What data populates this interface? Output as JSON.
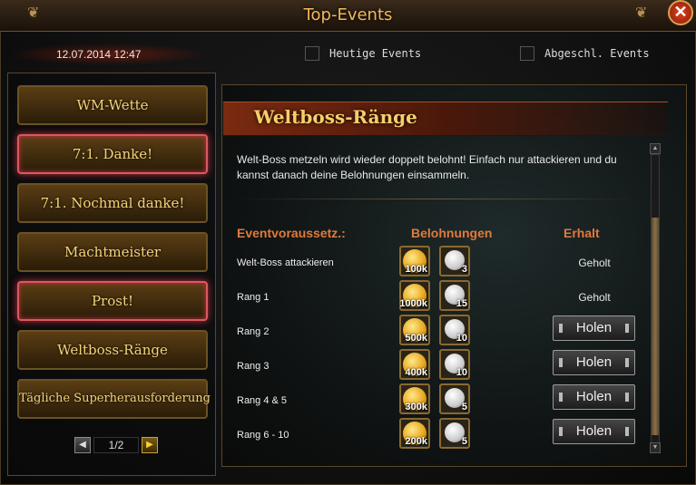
{
  "window": {
    "title": "Top-Events",
    "close_label": "✕"
  },
  "header": {
    "datetime": "12.07.2014 12:47",
    "checkbox_today": "Heutige Events",
    "checkbox_closed": "Abgeschl. Events"
  },
  "sidebar": {
    "items": [
      {
        "label": "WM-Wette",
        "active": false
      },
      {
        "label": "7:1. Danke!",
        "active": true
      },
      {
        "label": "7:1. Nochmal danke!",
        "active": false
      },
      {
        "label": "Machtmeister",
        "active": false
      },
      {
        "label": "Prost!",
        "active": true
      },
      {
        "label": "Weltboss-Ränge",
        "active": false
      },
      {
        "label": "Tägliche Superherausforderung",
        "active": false
      }
    ],
    "pager": {
      "prev": "◀",
      "label": "1/2",
      "next": "▶"
    }
  },
  "detail": {
    "title": "Weltboss-Ränge",
    "description": "Welt-Boss metzeln wird wieder doppelt belohnt! Einfach nur attackieren und du kannst danach deine Belohnungen einsammeln.",
    "headers": {
      "requirement": "Eventvoraussetz.:",
      "rewards": "Belohnungen",
      "status": "Erhalt"
    },
    "rows": [
      {
        "requirement": "Welt-Boss attackieren",
        "gold": "100k",
        "balls": "3",
        "status": "Geholt"
      },
      {
        "requirement": "Rang 1",
        "gold": "1000k",
        "balls": "15",
        "status": "Geholt"
      },
      {
        "requirement": "Rang 2",
        "gold": "500k",
        "balls": "10",
        "status": "Holen"
      },
      {
        "requirement": "Rang 3",
        "gold": "400k",
        "balls": "10",
        "status": "Holen"
      },
      {
        "requirement": "Rang 4 & 5",
        "gold": "300k",
        "balls": "5",
        "status": "Holen"
      },
      {
        "requirement": "Rang 6 - 10",
        "gold": "200k",
        "balls": "5",
        "status": "Holen"
      }
    ]
  },
  "icons": {
    "gold": "gold-coin-icon",
    "ball": "soccer-ball-icon"
  }
}
